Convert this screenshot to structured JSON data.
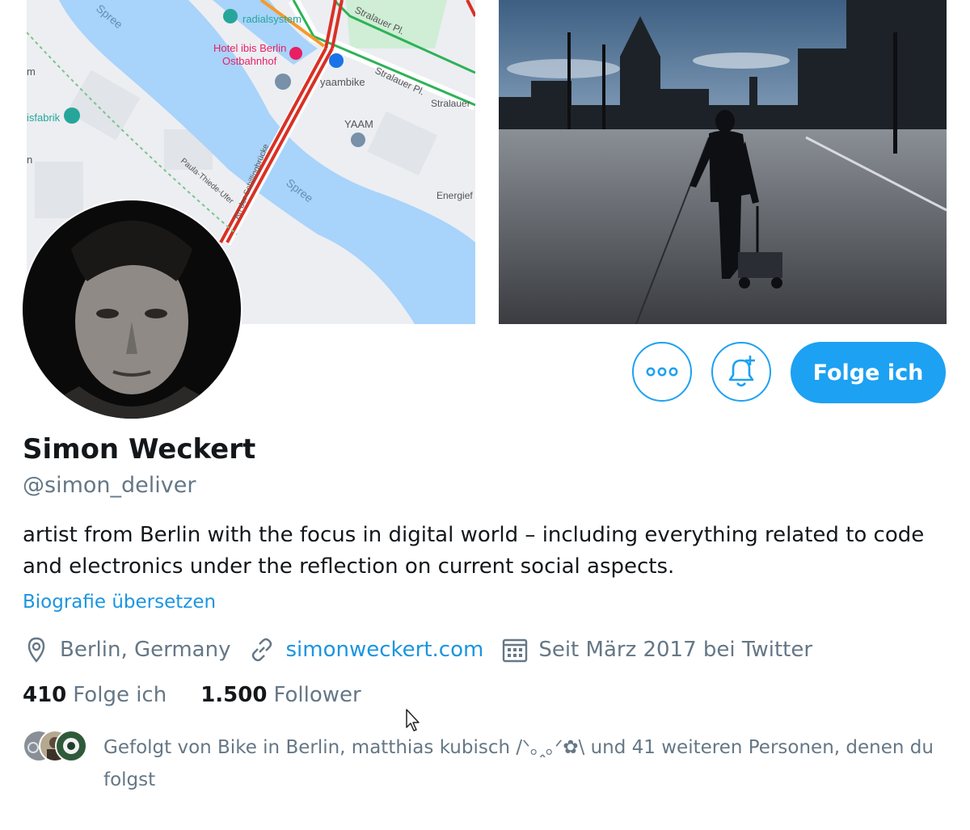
{
  "banner": {
    "map": {
      "labels": {
        "radialsystem": "radialsystem",
        "hotel_line1": "Hotel ibis Berlin",
        "hotel_line2": "Ostbahnhof",
        "yaambike": "yaambike",
        "yaam": "YAAM",
        "spree_top": "Spree",
        "spree_bottom": "Spree",
        "stralauer_top": "Stralauer Pl.",
        "stralauer_mid": "Stralauer Pl.",
        "stralauer_right": "Stralauer",
        "eisfabrik": "isfabrik",
        "paula": "Paula-Thiede-Ufer",
        "schilling": "An der Schillingbrücke",
        "energie": "Energief",
        "m": "m",
        "n": "n"
      }
    }
  },
  "actions": {
    "more_icon": "more-dots-icon",
    "bell_icon": "bell-plus-icon",
    "follow_label": "Folge ich"
  },
  "profile": {
    "name": "Simon Weckert",
    "handle": "@simon_deliver",
    "bio": "artist from Berlin with the focus in digital world – including everything related to code and electronics under the reflection on current social aspects.",
    "translate": "Biografie übersetzen",
    "location": "Berlin, Germany",
    "website": "simonweckert.com",
    "joined": "Seit März 2017 bei Twitter"
  },
  "stats": {
    "following_count": "410",
    "following_label": "Folge ich",
    "followers_count": "1.500",
    "followers_label": "Follower"
  },
  "followed_by": {
    "text": "Gefolgt von Bike in Berlin, matthias kubisch /ᐠ｡ꞈ｡ᐟ✿\\ und 41 weiteren Personen, denen du folgst"
  },
  "colors": {
    "accent": "#1da1f2",
    "link": "#1b95e0",
    "muted": "#657786",
    "text": "#14171a"
  }
}
